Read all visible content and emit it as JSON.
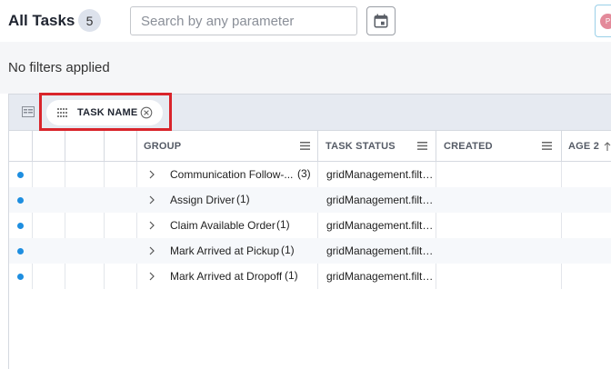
{
  "header": {
    "title": "All Tasks",
    "count": "5",
    "search_placeholder": "Search by any parameter",
    "avatar_initial": "P"
  },
  "filters": {
    "status_text": "No filters applied"
  },
  "group_panel": {
    "chip_label": "TASK NAME"
  },
  "columns": [
    {
      "label": "GROUP"
    },
    {
      "label": "TASK STATUS"
    },
    {
      "label": "CREATED"
    },
    {
      "label": "AGE 2"
    }
  ],
  "rows": [
    {
      "group": "Communication Follow-...",
      "count": "(3)",
      "status": "gridManagement.filters.status.pending"
    },
    {
      "group": "Assign Driver",
      "count": "(1)",
      "status": "gridManagement.filters.status.pending"
    },
    {
      "group": "Claim Available Order",
      "count": "(1)",
      "status": "gridManagement.filters.status.pending"
    },
    {
      "group": "Mark Arrived at Pickup",
      "count": "(1)",
      "status": "gridManagement.filters.status.pending"
    },
    {
      "group": "Mark Arrived at Dropoff",
      "count": "(1)",
      "status": "gridManagement.filters.status.pending"
    }
  ],
  "colors": {
    "accent": "#1e8ee0",
    "highlight": "#d9242b",
    "panel_bg": "#e6eaf1"
  }
}
